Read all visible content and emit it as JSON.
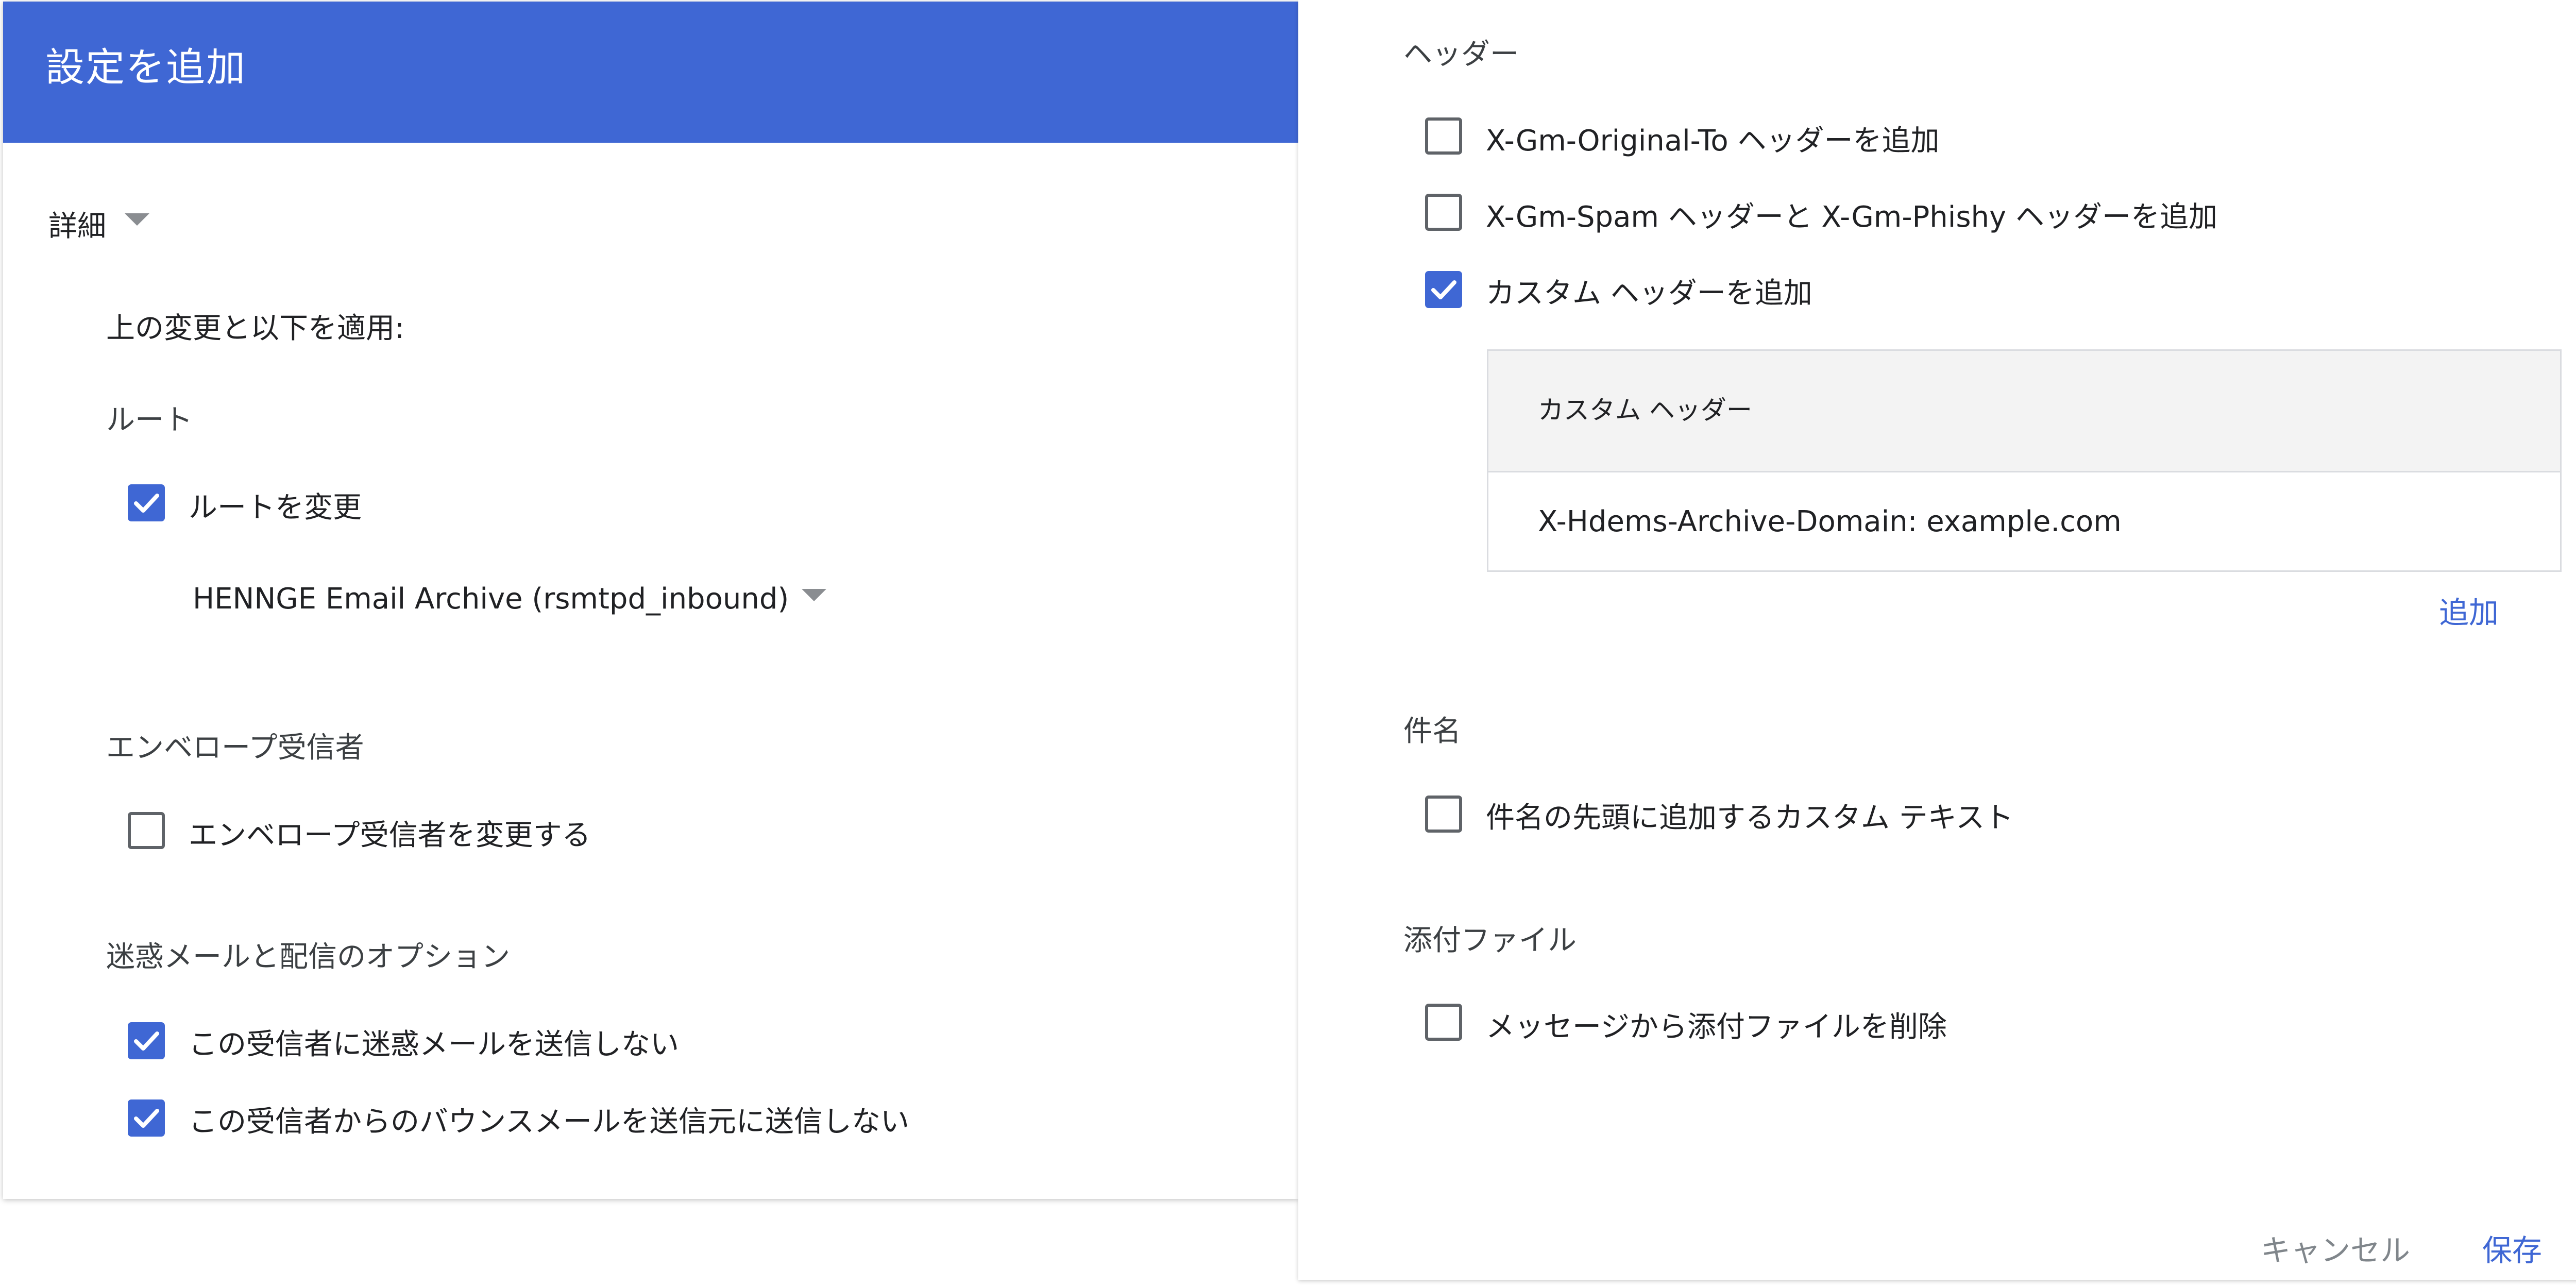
{
  "dialog": {
    "title": "設定を追加"
  },
  "left": {
    "details_label": "詳細",
    "apply_label": "上の変更と以下を適用:",
    "route": {
      "section": "ルート",
      "change_route_label": "ルートを変更",
      "change_route_checked": true,
      "route_select_value": "HENNGE Email Archive (rsmtpd_inbound)"
    },
    "envelope": {
      "section": "エンベロープ受信者",
      "change_label": "エンベロープ受信者を変更する",
      "change_checked": false
    },
    "spam": {
      "section": "迷惑メールと配信のオプション",
      "no_spam_label": "この受信者に迷惑メールを送信しない",
      "no_spam_checked": true,
      "no_bounce_label": "この受信者からのバウンスメールを送信元に送信しない",
      "no_bounce_checked": true
    }
  },
  "right": {
    "headers": {
      "section": "ヘッダー",
      "original_to_label": "X-Gm-Original-To ヘッダーを追加",
      "original_to_checked": false,
      "spam_phishy_label": "X-Gm-Spam ヘッダーと X-Gm-Phishy ヘッダーを追加",
      "spam_phishy_checked": false,
      "custom_label": "カスタム ヘッダーを追加",
      "custom_checked": true,
      "table_header": "カスタム ヘッダー",
      "rows": [
        "X-Hdems-Archive-Domain: example.com"
      ],
      "add_link": "追加"
    },
    "subject": {
      "section": "件名",
      "prefix_label": "件名の先頭に追加するカスタム テキスト",
      "prefix_checked": false
    },
    "attachments": {
      "section": "添付ファイル",
      "remove_label": "メッセージから添付ファイルを削除",
      "remove_checked": false
    }
  },
  "footer": {
    "cancel_label": "キャンセル",
    "save_label": "保存"
  },
  "colors": {
    "accent": "#3f67d4",
    "text": "#202124",
    "muted": "#80868b"
  }
}
